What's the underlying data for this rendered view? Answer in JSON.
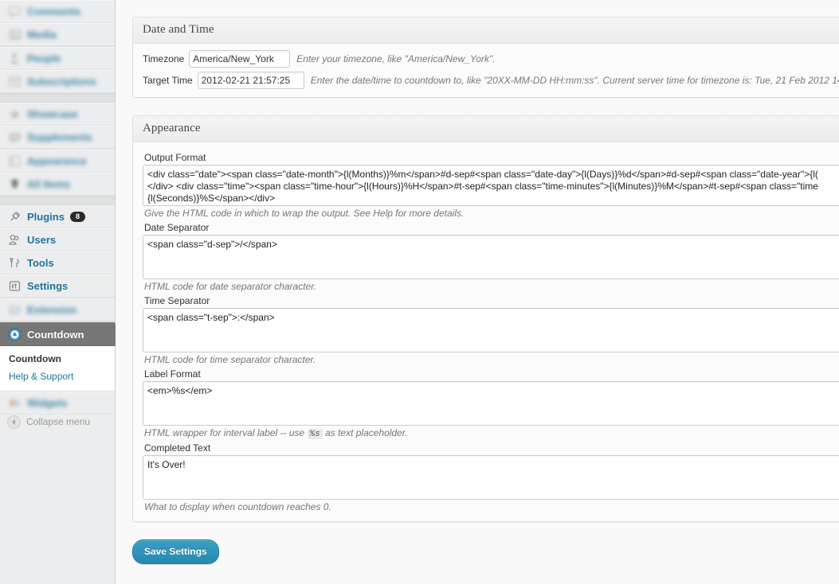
{
  "sidebar": {
    "groups": [
      {
        "items": [
          {
            "label": "Comments",
            "icon": "comment-icon",
            "name": "sidebar-item-redacted-1",
            "blurred": true
          },
          {
            "label": "Media",
            "icon": "media-icon",
            "name": "sidebar-item-redacted-2",
            "blurred": true
          }
        ]
      },
      {
        "items": [
          {
            "label": "People",
            "icon": "people-icon",
            "name": "sidebar-item-redacted-3",
            "blurred": true
          },
          {
            "label": "Subscriptions",
            "icon": "grid-icon",
            "name": "sidebar-item-redacted-4",
            "blurred": true
          }
        ]
      },
      {
        "items": [
          {
            "label": "Showcase",
            "icon": "star-icon",
            "name": "sidebar-item-redacted-5",
            "blurred": true
          },
          {
            "label": "Supplements",
            "icon": "flag-icon",
            "name": "sidebar-item-redacted-6",
            "blurred": true
          }
        ]
      },
      {
        "items": [
          {
            "label": "Appearance",
            "icon": "appearance-icon",
            "name": "sidebar-item-redacted-7",
            "blurred": true
          },
          {
            "label": "All Items",
            "icon": "pin-icon",
            "name": "sidebar-item-redacted-8",
            "blurred": true
          }
        ]
      },
      {
        "items": [
          {
            "label": "Plugins",
            "icon": "plug-icon",
            "name": "sidebar-item-plugins",
            "blurred": false,
            "badge": "8"
          },
          {
            "label": "Users",
            "icon": "users-icon",
            "name": "sidebar-item-users",
            "blurred": false
          },
          {
            "label": "Tools",
            "icon": "tools-icon",
            "name": "sidebar-item-tools",
            "blurred": false
          },
          {
            "label": "Settings",
            "icon": "settings-icon",
            "name": "sidebar-item-settings",
            "blurred": false
          }
        ]
      },
      {
        "items": [
          {
            "label": "Extension",
            "icon": "extension-icon",
            "name": "sidebar-item-redacted-9",
            "blurred": true
          }
        ]
      }
    ],
    "current": {
      "label": "Countdown",
      "icon": "countdown-clock-icon",
      "submenu": [
        {
          "label": "Countdown",
          "active": true
        },
        {
          "label": "Help & Support",
          "active": false
        }
      ]
    },
    "trailing": [
      {
        "label": "Widgets",
        "icon": "widgets-icon",
        "name": "sidebar-item-redacted-10",
        "blurred": true
      }
    ],
    "collapse_label": "Collapse menu",
    "collapse_icon": "collapse-arrow-icon"
  },
  "date_time_panel": {
    "title": "Date and Time",
    "timezone": {
      "label": "Timezone",
      "value": "America/New_York",
      "placeholder": "America/New_York",
      "hint": "Enter your timezone, like \"America/New_York\"."
    },
    "target_time": {
      "label": "Target Time",
      "value": "2012-02-21 21:57:25",
      "placeholder": "20XX-MM-DD HH:mm:ss",
      "hint": "Enter the date/time to countdown to, like \"20XX-MM-DD HH:mm:ss\". Current server time for timezone is: Tue, 21 Feb 2012 14"
    }
  },
  "appearance_panel": {
    "title": "Appearance",
    "fields": [
      {
        "label": "Output Format",
        "value": "<div class=\"date\"><span class=\"date-month\">{l(Months)}%m</span>#d-sep#<span class=\"date-day\">{l(Days)}%d</span>#d-sep#<span class=\"date-year\">{l(\n</div> <div class=\"time\"><span class=\"time-hour\">{l(Hours)}%H</span>#t-sep#<span class=\"time-minutes\">{l(Minutes)}%M</span>#t-sep#<span class=\"time\n{l(Seconds)}%S</span></div>",
        "hint": "Give the HTML code in which to wrap the output. See Help for more details."
      },
      {
        "label": "Date Separator",
        "value": "<span class=\"d-sep\">/</span>",
        "hint": "HTML code for date separator character."
      },
      {
        "label": "Time Separator",
        "value": "<span class=\"t-sep\">:</span>",
        "hint": "HTML code for time separator character."
      },
      {
        "label": "Label Format",
        "value": "<em>%s</em>",
        "hint_before": "HTML wrapper for interval label -- use",
        "hint_code": "%s",
        "hint_after": "as text placeholder."
      },
      {
        "label": "Completed Text",
        "value": "It's Over!",
        "hint": "What to display when countdown reaches 0."
      }
    ]
  },
  "save_button": {
    "label": "Save Settings"
  },
  "colors": {
    "link": "#21759b",
    "button": "#2b8fb4",
    "sidebar_bg": "#ecedee",
    "active_menu_bg": "#777777",
    "page_bg": "#f9f9f9"
  }
}
